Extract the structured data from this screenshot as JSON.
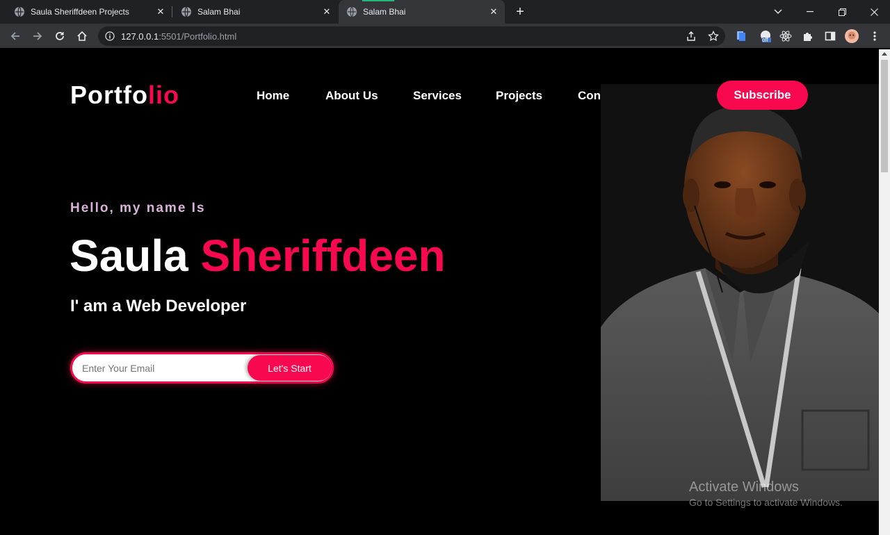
{
  "browser": {
    "tabs": [
      {
        "title": "Saula Sheriffdeen Projects",
        "active": false
      },
      {
        "title": "Salam Bhai",
        "active": false
      },
      {
        "title": "Salam Bhai",
        "active": true
      }
    ],
    "url_host": "127.0.0.1",
    "url_rest": ":5501/Portfolio.html",
    "profile_badge": "off"
  },
  "site": {
    "logo_main": "Portfo",
    "logo_accent": "lio",
    "nav": [
      "Home",
      "About Us",
      "Services",
      "Projects",
      "Contact Us"
    ],
    "subscribe_label": "Subscribe"
  },
  "hero": {
    "greeting": "Hello, my name Is",
    "first_name": "Saula",
    "last_name": "Sheriffdeen",
    "role": "I' am a Web Developer",
    "email_placeholder": "Enter Your Email",
    "cta_label": "Let's Start"
  },
  "watermark": {
    "title": "Activate Windows",
    "subtitle": "Go to Settings to activate Windows."
  },
  "colors": {
    "accent": "#f7084f",
    "greeting": "#d8b2d8",
    "background": "#000000"
  }
}
